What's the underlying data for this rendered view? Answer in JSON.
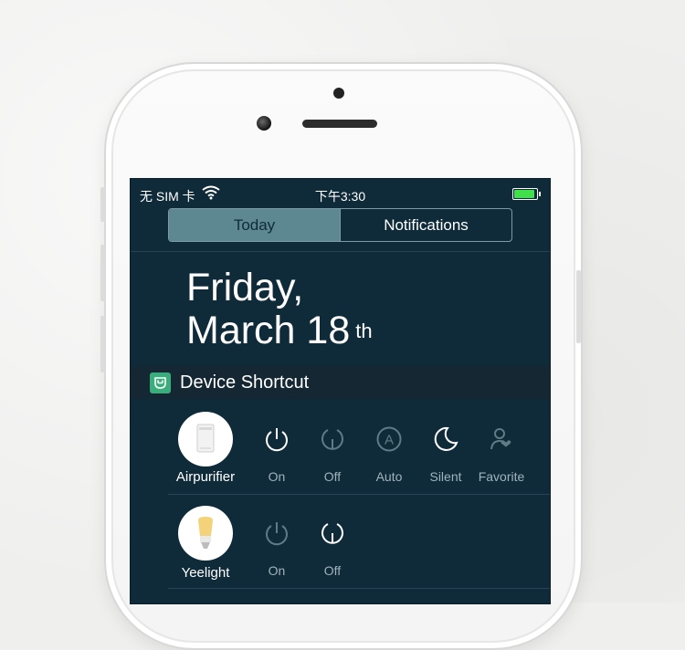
{
  "status": {
    "carrier": "无 SIM 卡",
    "time": "下午3:30",
    "battery_level": 1.0
  },
  "tabs": [
    {
      "label": "Today",
      "active": true
    },
    {
      "label": "Notifications",
      "active": false
    }
  ],
  "date": {
    "line1": "Friday,",
    "line2": "March 18",
    "suffix": "th"
  },
  "section": {
    "title": "Device Shortcut",
    "icon": "mi-home-icon",
    "icon_color": "#3aad7c"
  },
  "devices": [
    {
      "name": "Airpurifier",
      "icon": "air-purifier-icon",
      "actions": [
        {
          "label": "On",
          "icon": "power-on-icon",
          "enabled": true
        },
        {
          "label": "Off",
          "icon": "power-off-icon",
          "enabled": false
        },
        {
          "label": "Auto",
          "icon": "auto-mode-icon",
          "enabled": false
        },
        {
          "label": "Silent",
          "icon": "moon-icon",
          "enabled": true
        },
        {
          "label": "Favorite",
          "icon": "favorite-user-icon",
          "enabled": false
        }
      ]
    },
    {
      "name": "Yeelight",
      "icon": "light-bulb-icon",
      "actions": [
        {
          "label": "On",
          "icon": "power-on-icon",
          "enabled": false
        },
        {
          "label": "Off",
          "icon": "power-off-icon",
          "enabled": true
        }
      ]
    }
  ],
  "colors": {
    "screen_bg": "#0f2b3a",
    "active_tab": "#5d8791",
    "enabled_icon": "#ffffff",
    "disabled_icon": "#5f7b86"
  }
}
